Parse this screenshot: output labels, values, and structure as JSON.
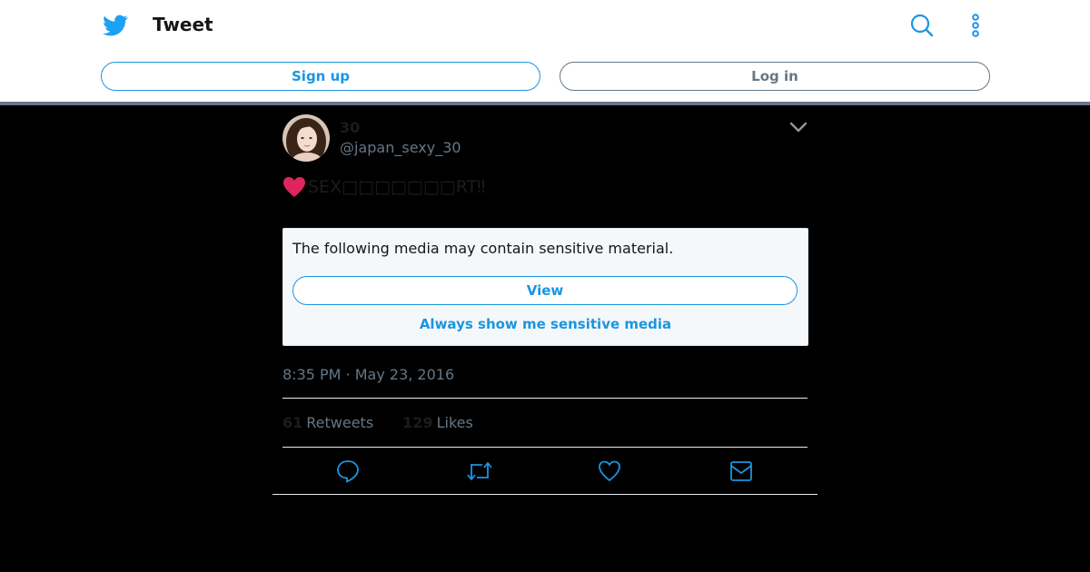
{
  "header": {
    "title": "Tweet",
    "signup_label": "Sign up",
    "login_label": "Log in",
    "brand_icon": "twitter-bird-icon",
    "search_icon": "search-icon",
    "more_icon": "more-vertical-icon"
  },
  "tweet": {
    "display_name": "30",
    "handle": "@japan_sexy_30",
    "text_emoji": "heart-emoji",
    "text": "SEX□□□□□□□RT‼",
    "timestamp": "8:35 PM · May 23, 2016",
    "retweets_count": "61",
    "retweets_label": "Retweets",
    "likes_count": "129",
    "likes_label": "Likes"
  },
  "sensitive": {
    "message": "The following media may contain sensitive material.",
    "view_label": "View",
    "always_label": "Always show me sensitive media"
  },
  "actions": [
    "reply-icon",
    "retweet-icon",
    "like-icon",
    "direct-message-icon"
  ],
  "colors": {
    "brand": "#1b95e0",
    "muted": "#657786",
    "heart": "#e0245e"
  }
}
